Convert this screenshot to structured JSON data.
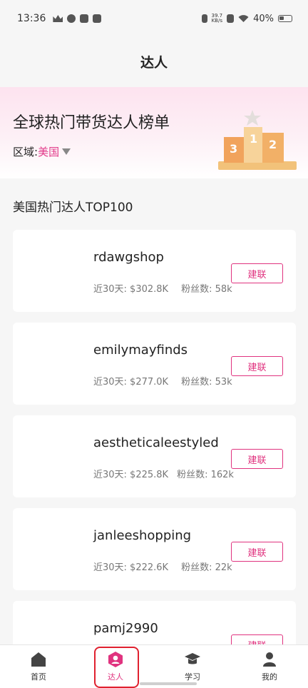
{
  "status_bar": {
    "time": "13:36",
    "net_speed_top": "39.7",
    "net_speed_bottom": "KB/s",
    "battery": "40%"
  },
  "header": {
    "title": "达人"
  },
  "banner": {
    "title": "全球热门带货达人榜单",
    "region_label": "区域:",
    "region_value": "美国"
  },
  "section_title": "美国热门达人TOP100",
  "creators": [
    {
      "name": "rdawgshop",
      "sales": "近30天: $302.8K",
      "followers": "粉丝数: 58k",
      "button": "建联"
    },
    {
      "name": "emilymayfinds",
      "sales": "近30天: $277.0K",
      "followers": "粉丝数: 53k",
      "button": "建联"
    },
    {
      "name": "aestheticaleestyled",
      "sales": "近30天: $225.8K",
      "followers": "粉丝数: 162k",
      "button": "建联"
    },
    {
      "name": "janleeshopping",
      "sales": "近30天: $222.6K",
      "followers": "粉丝数: 22k",
      "button": "建联"
    },
    {
      "name": "pamj2990",
      "sales": "",
      "followers": "",
      "button": "建联"
    }
  ],
  "nav": {
    "home": "首页",
    "creators": "达人",
    "learn": "学习",
    "mine": "我的"
  },
  "colors": {
    "accent": "#e0337f",
    "active_outline": "#e0212f"
  }
}
